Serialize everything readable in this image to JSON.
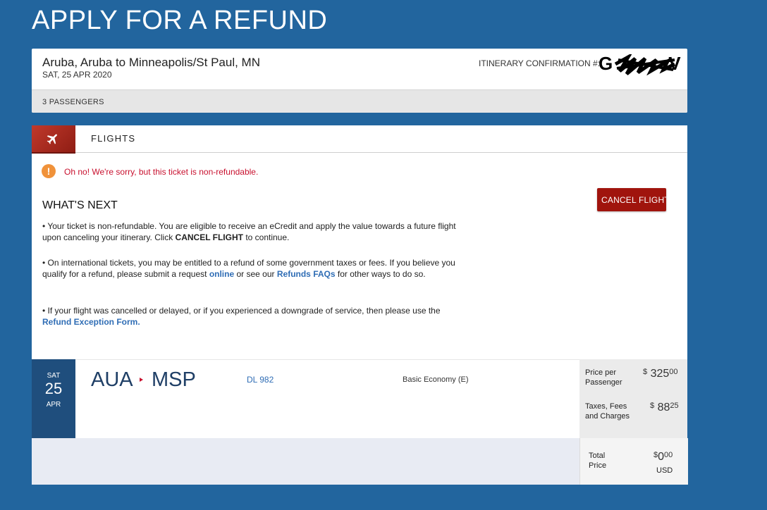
{
  "page": {
    "title": "APPLY FOR A REFUND"
  },
  "trip": {
    "route": "Aruba, Aruba to Minneapolis/St Paul, MN",
    "date": "SAT, 25 APR 2020",
    "confirmation_label": "ITINERARY CONFIRMATION #:",
    "confirmation_visible": "G",
    "confirmation_tail": "V",
    "passengers": "3 PASSENGERS"
  },
  "flights_tab": {
    "label": "FLIGHTS",
    "icon": "airplane-icon"
  },
  "alert": {
    "icon": "exclamation-icon",
    "text": "Oh no! We're sorry, but this ticket is non-refundable."
  },
  "actions": {
    "cancel_label": "CANCEL FLIGHT"
  },
  "whats_next": {
    "heading": "WHAT'S NEXT",
    "p1_a": "• Your ticket is non-refundable. You are eligible to receive an eCredit and apply the value towards a future flight upon canceling your itinerary. Click ",
    "p1_b": "CANCEL FLIGHT",
    "p1_c": " to continue.",
    "p2_a": "• On international tickets, you may be entitled to a refund of some government taxes or fees. If you believe you qualify for a refund, please submit a request ",
    "p2_link1": "online",
    "p2_b": " or see our ",
    "p2_link2": "Refunds FAQs",
    "p2_c": " for other ways to do so.",
    "p3_a": "• If your flight was cancelled or delayed, or if you experienced a downgrade of service, then please use the ",
    "p3_link": "Refund Exception Form."
  },
  "flight": {
    "dow": "SAT",
    "day": "25",
    "month": "APR",
    "origin": "AUA",
    "destination": "MSP",
    "flight_number": "DL 982",
    "cabin": "Basic Economy (E)"
  },
  "pricing": {
    "per_passenger_label": "Price per Passenger",
    "per_passenger_currency": "$",
    "per_passenger_whole": "325",
    "per_passenger_cents": "00",
    "taxes_label": "Taxes, Fees and Charges",
    "taxes_currency": "$",
    "taxes_whole": "88",
    "taxes_cents": "25",
    "total_label": "Total Price",
    "total_currency": "$",
    "total_whole": "0",
    "total_cents": "00",
    "total_unit": "USD"
  },
  "colors": {
    "background": "#22659e",
    "accent_red": "#a0140d",
    "link": "#2f6db5",
    "date_block": "#1f4e7d"
  }
}
